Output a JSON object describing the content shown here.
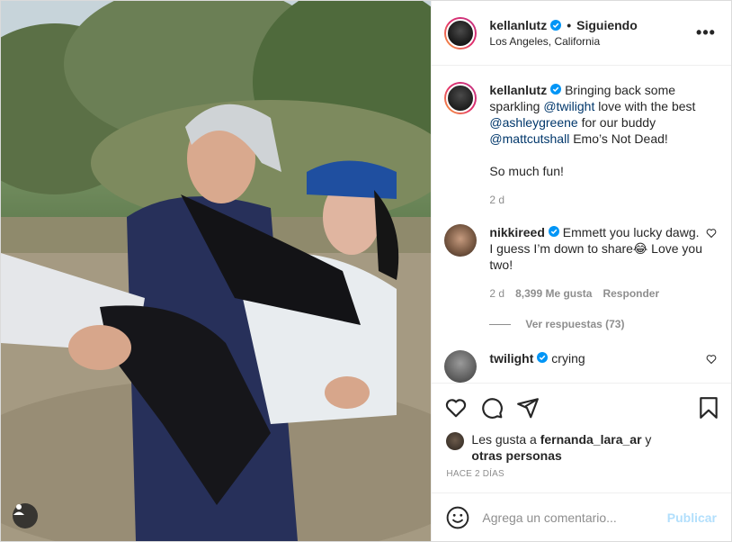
{
  "post": {
    "username": "kellanlutz",
    "follow_label": "Siguiendo",
    "separator": "•",
    "location": "Los Angeles, California",
    "more_label": "•••"
  },
  "caption": {
    "username": "kellanlutz",
    "text_1": "Bringing back some sparkling ",
    "mention_1": "@twilight",
    "text_2": " love with the best ",
    "mention_2": "@ashleygreene",
    "text_3": " for our buddy ",
    "mention_3": "@mattcutshall",
    "text_4": " Emo’s Not Dead!",
    "text_5": "So much fun!",
    "time": "2 d"
  },
  "comments": [
    {
      "username": "nikkireed",
      "text": "Emmett you lucky dawg. I guess I’m down to share😂 Love you two!",
      "time": "2 d",
      "likes": "8,399 Me gusta",
      "reply_label": "Responder"
    },
    {
      "username": "twilight",
      "text": "crying"
    }
  ],
  "replies_label": "Ver respuestas (73)",
  "likes": {
    "prefix": "Les gusta a ",
    "user": "fernanda_lara_ar",
    "middle": " y",
    "others": "otras personas"
  },
  "timestamp": "HACE 2 DÍAS",
  "add_comment": {
    "placeholder": "Agrega un comentario...",
    "publish_label": "Publicar"
  },
  "icons": {
    "like": "heart-icon",
    "comment": "comment-icon",
    "share": "paper-plane-icon",
    "save": "bookmark-icon",
    "emoji": "smiley-icon",
    "tag": "user-tag-icon",
    "verified": "verified-badge-icon"
  },
  "colors": {
    "verified": "#0095f6",
    "mention": "#00376b",
    "publish_disabled": "#b2dffc",
    "secondary_text": "#8e8e8e"
  }
}
